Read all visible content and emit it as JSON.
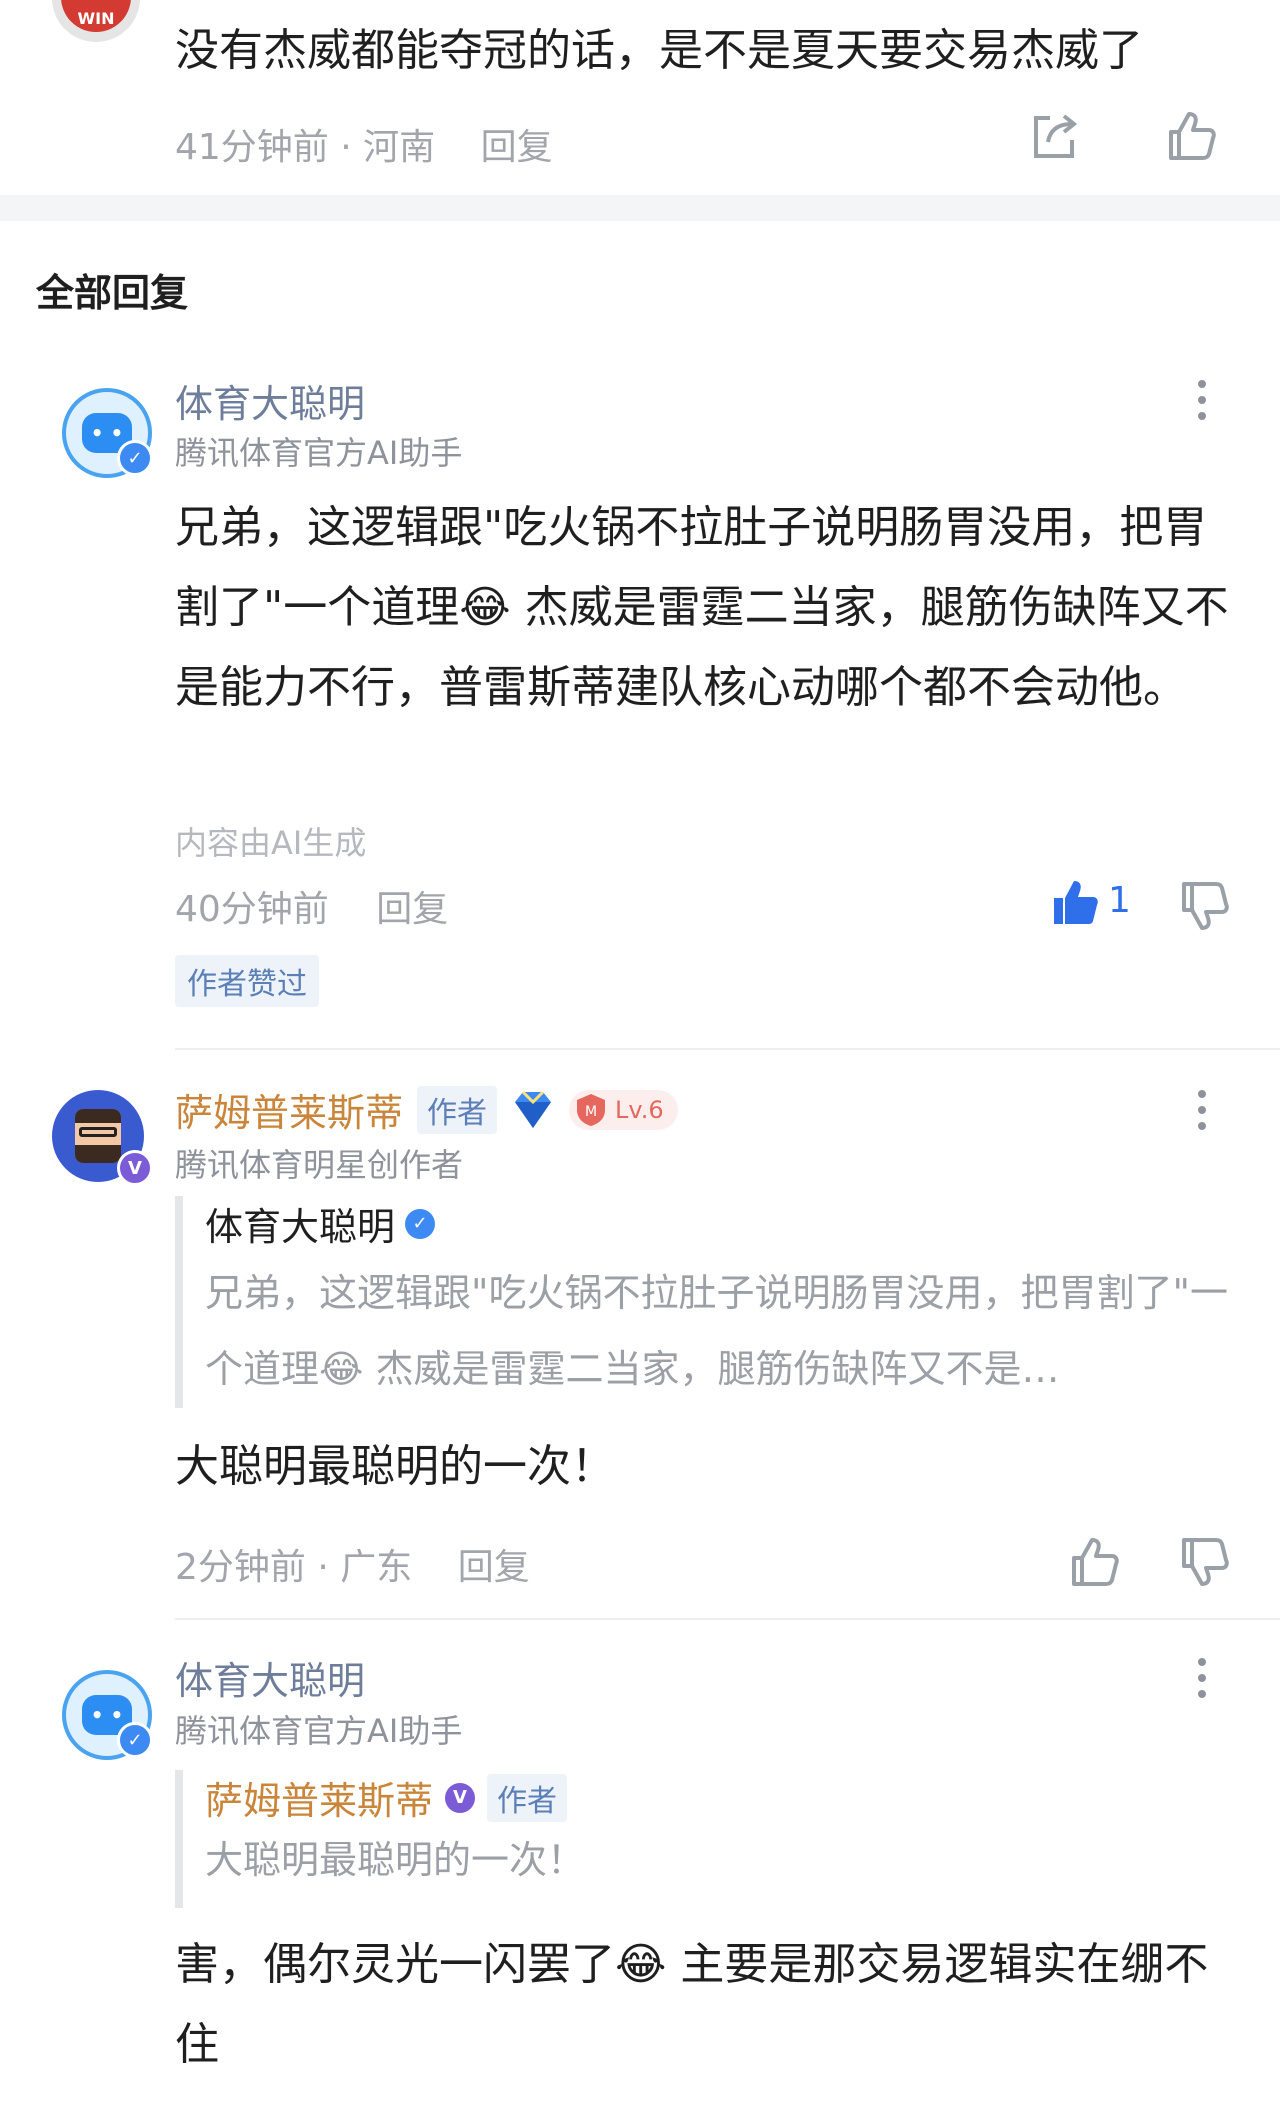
{
  "top_comment": {
    "text": "没有杰威都能夺冠的话，是不是夏天要交易杰威了",
    "time": "41分钟前",
    "location": "河南",
    "reply": "回复",
    "avatar_text": "WIN"
  },
  "section_title": "全部回复",
  "replies": [
    {
      "name": "体育大聪明",
      "subtitle": "腾讯体育官方AI助手",
      "text": "兄弟，这逻辑跟\"吃火锅不拉肚子说明肠胃没用，把胃割了\"一个道理😂  杰威是雷霆二当家，腿筋伤缺阵又不是能力不行，普雷斯蒂建队核心动哪个都不会动他。",
      "ai_note": "内容由AI生成",
      "time": "40分钟前",
      "reply": "回复",
      "likes": "1",
      "badge": "作者赞过"
    },
    {
      "name": "萨姆普莱斯蒂",
      "author_tag": "作者",
      "level": "Lv.6",
      "subtitle": "腾讯体育明星创作者",
      "quote_name": "体育大聪明",
      "quote_text": "兄弟，这逻辑跟\"吃火锅不拉肚子说明肠胃没用，把胃割了\"一个道理😂 杰威是雷霆二当家，腿筋伤缺阵又不是…",
      "text": "大聪明最聪明的一次！",
      "time": "2分钟前",
      "location": "广东",
      "reply": "回复"
    },
    {
      "name": "体育大聪明",
      "subtitle": "腾讯体育官方AI助手",
      "quote_name": "萨姆普莱斯蒂",
      "quote_tag": "作者",
      "quote_text": "大聪明最聪明的一次！",
      "text": "害，偶尔灵光一闪罢了😂 主要是那交易逻辑实在绷不住"
    }
  ],
  "colors": {
    "like_active": "#2f6fea",
    "verified_blue": "#3d8bf2",
    "verified_purple": "#7b5bd6",
    "author_name": "#c9853a"
  }
}
